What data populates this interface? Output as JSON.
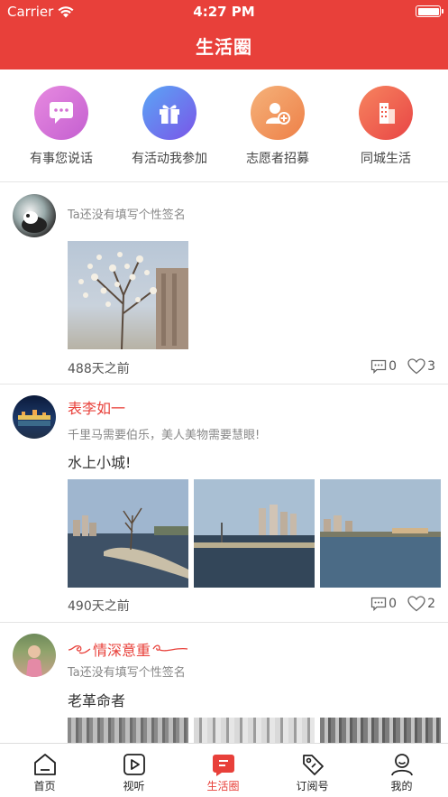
{
  "status": {
    "carrier": "Carrier",
    "time": "4:27 PM"
  },
  "header": {
    "title": "生活圈"
  },
  "quick": [
    {
      "label": "有事您说话",
      "icon": "chat-icon",
      "color": "#d36fd3"
    },
    {
      "label": "有活动我参加",
      "icon": "gift-icon",
      "color": "#6a6ef0"
    },
    {
      "label": "志愿者招募",
      "icon": "add-user-icon",
      "color": "#f08a4f"
    },
    {
      "label": "同城生活",
      "icon": "building-icon",
      "color": "#f25b4b"
    }
  ],
  "posts": [
    {
      "name": "",
      "signature": "Ta还没有填写个性签名",
      "content": "",
      "time": "488天之前",
      "comments": "0",
      "likes": "3"
    },
    {
      "name": "表李如一",
      "signature": "千里马需要伯乐，美人美物需要慧眼!",
      "content": "水上小城!",
      "time": "490天之前",
      "comments": "0",
      "likes": "2"
    },
    {
      "name": "情深意重",
      "signature": "Ta还没有填写个性签名",
      "content": "老革命者"
    }
  ],
  "tabbar": [
    {
      "label": "首页",
      "icon": "home-icon"
    },
    {
      "label": "视听",
      "icon": "play-icon"
    },
    {
      "label": "生活圈",
      "icon": "life-circle-icon",
      "active": true
    },
    {
      "label": "订阅号",
      "icon": "tag-icon"
    },
    {
      "label": "我的",
      "icon": "profile-icon"
    }
  ],
  "colors": {
    "accent": "#e8403a"
  }
}
